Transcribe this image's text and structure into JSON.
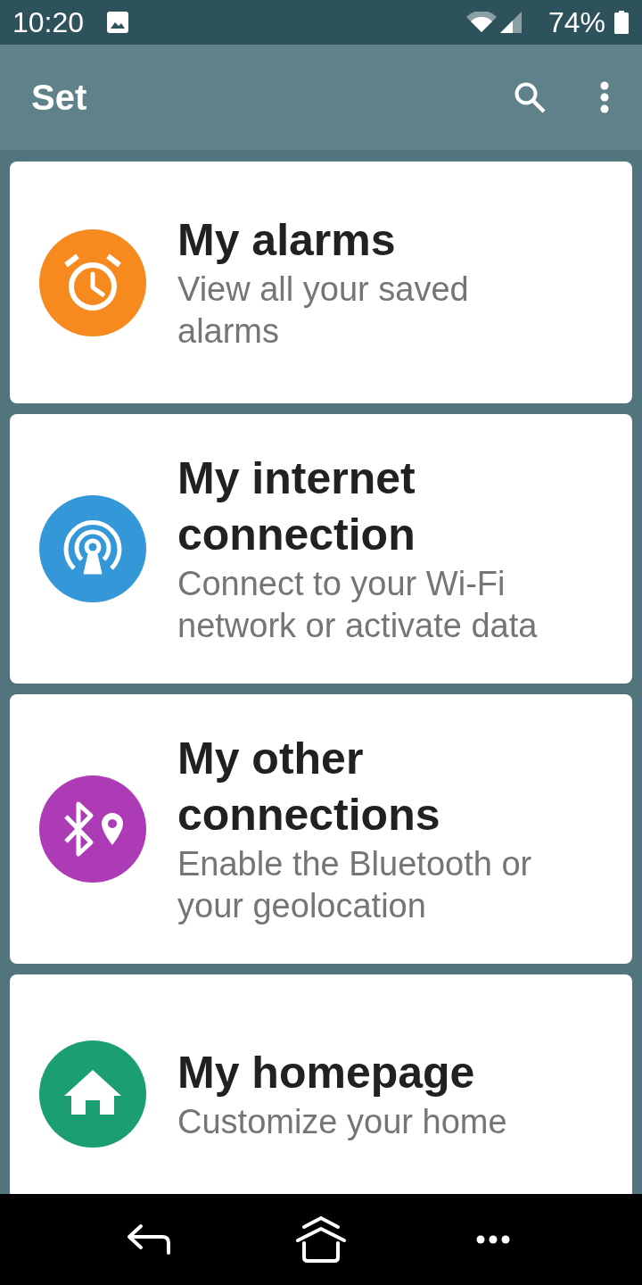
{
  "status_bar": {
    "time": "10:20",
    "battery": "74%"
  },
  "app_bar": {
    "title": "Set"
  },
  "items": [
    {
      "title": "My alarms",
      "subtitle": "View all your saved alarms",
      "color": "#f68a1e"
    },
    {
      "title": "My internet connection",
      "subtitle": "Connect to your Wi-Fi network or activate data",
      "color": "#3498d8"
    },
    {
      "title": "My other connections",
      "subtitle": "Enable the Bluetooth or your geolocation",
      "color": "#ae3bb6"
    },
    {
      "title": "My homepage",
      "subtitle": "Customize your home",
      "color": "#1b9e74"
    }
  ]
}
